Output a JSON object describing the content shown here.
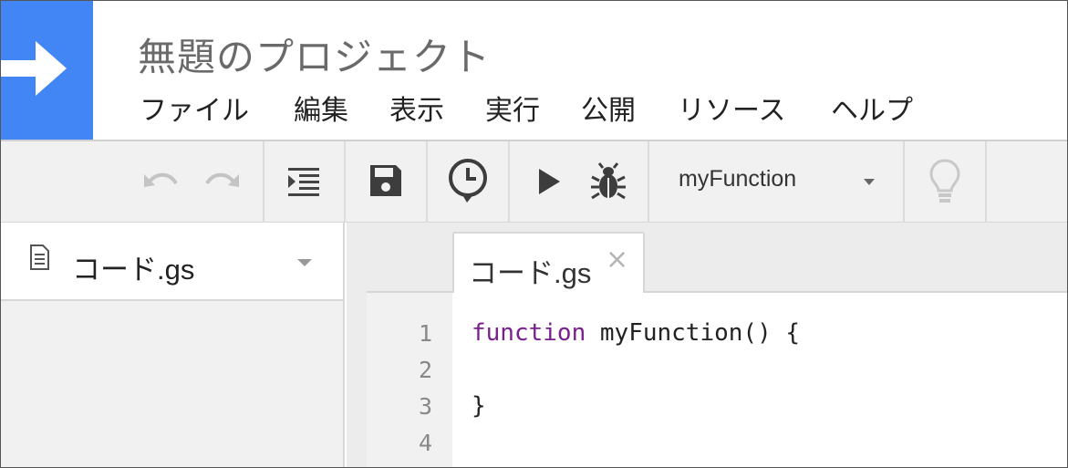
{
  "app": {
    "title": "無題のプロジェクト"
  },
  "menu": {
    "items": [
      {
        "label": "ファイル"
      },
      {
        "label": "編集"
      },
      {
        "label": "表示"
      },
      {
        "label": "実行"
      },
      {
        "label": "公開"
      },
      {
        "label": "リソース"
      },
      {
        "label": "ヘルプ"
      }
    ]
  },
  "toolbar": {
    "icons": {
      "undo": "undo-icon",
      "redo": "redo-icon",
      "indent": "indent-icon",
      "save": "save-icon",
      "triggers": "clock-icon",
      "run": "play-icon",
      "debug": "bug-icon",
      "hint": "lightbulb-icon"
    },
    "function_select": {
      "selected": "myFunction"
    }
  },
  "files": {
    "items": [
      {
        "name": "コード.gs"
      }
    ]
  },
  "editor": {
    "tab": {
      "label": "コード.gs",
      "close": "×"
    },
    "lines": [
      {
        "number": "1",
        "keyword": "function",
        "text": " myFunction() {"
      },
      {
        "number": "2",
        "keyword": "",
        "text": ""
      },
      {
        "number": "3",
        "keyword": "",
        "text": "}"
      },
      {
        "number": "4",
        "keyword": "",
        "text": ""
      }
    ]
  },
  "colors": {
    "brand_blue": "#4285f4",
    "keyword_purple": "#7a1f8f",
    "toolbar_bg": "#f1f1f1"
  }
}
